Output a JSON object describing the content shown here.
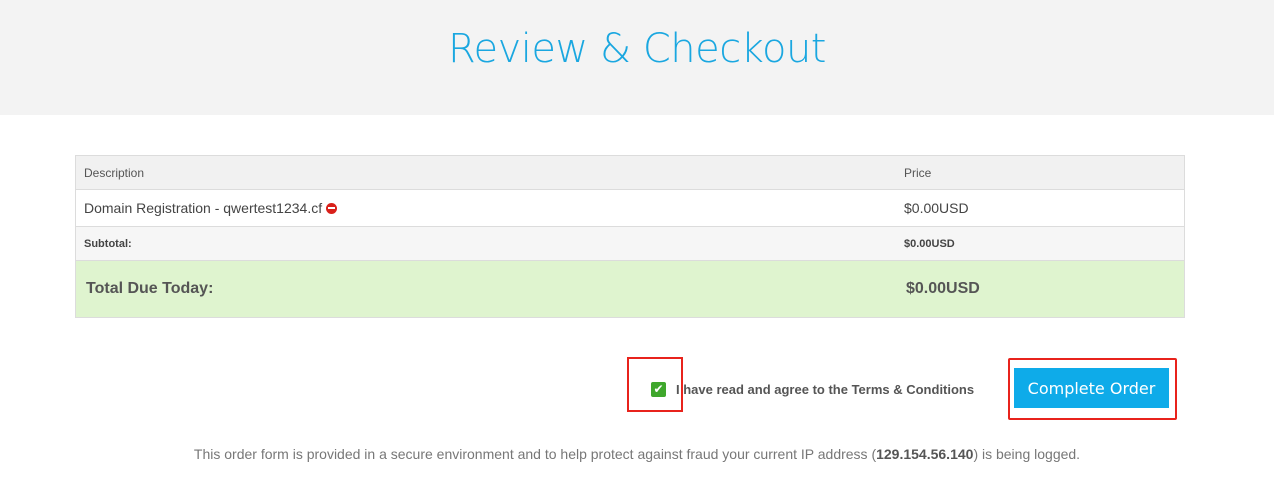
{
  "header": {
    "title": "Review & Checkout"
  },
  "cart": {
    "columns": {
      "description": "Description",
      "price": "Price"
    },
    "item": {
      "description": "Domain Registration - qwertest1234.cf",
      "price": "$0.00USD"
    },
    "subtotal": {
      "label": "Subtotal:",
      "value": "$0.00USD"
    },
    "total": {
      "label": "Total Due Today:",
      "value": "$0.00USD"
    }
  },
  "agree": {
    "prefix": "I have read and agree to the ",
    "link": "Terms & Conditions",
    "checked": true
  },
  "actions": {
    "complete_order": "Complete Order"
  },
  "footer": {
    "prefix": "This order form is provided in a secure environment and to help protect against fraud your current IP address (",
    "ip": "129.154.56.140",
    "suffix": ") is being logged."
  },
  "colors": {
    "accent": "#0eabe9",
    "title": "#1aa7e0",
    "total_bg": "#dff4cf",
    "check": "#3fa72c",
    "remove": "#d9201a",
    "highlight": "#e8231c"
  }
}
